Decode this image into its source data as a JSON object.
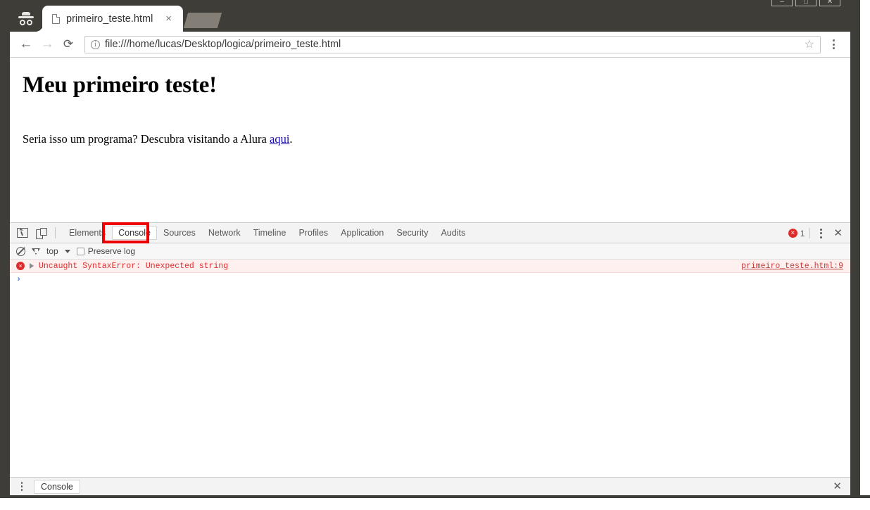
{
  "browser": {
    "incognito_icon": "incognito-icon",
    "window_controls": [
      "minimize",
      "maximize",
      "close"
    ],
    "tab": {
      "title": "primeiro_teste.html",
      "favicon": "page-file-icon",
      "close_label": "×"
    },
    "toolbar": {
      "back_icon": "←",
      "forward_icon": "→",
      "reload_icon": "⟳",
      "site_info_icon": "i",
      "url": "file:///home/lucas/Desktop/logica/primeiro_teste.html",
      "bookmark_icon": "☆"
    }
  },
  "page": {
    "heading": "Meu primeiro teste!",
    "paragraph_before": "Seria isso um programa? Descubra visitando a Alura ",
    "link_text": "aqui",
    "paragraph_after": "."
  },
  "devtools": {
    "tabs": [
      {
        "label": "Elements",
        "selected": false
      },
      {
        "label": "Console",
        "selected": true
      },
      {
        "label": "Sources",
        "selected": false
      },
      {
        "label": "Network",
        "selected": false
      },
      {
        "label": "Timeline",
        "selected": false
      },
      {
        "label": "Profiles",
        "selected": false
      },
      {
        "label": "Application",
        "selected": false
      },
      {
        "label": "Security",
        "selected": false
      },
      {
        "label": "Audits",
        "selected": false
      }
    ],
    "highlight_color": "#ee0000",
    "error_badge": {
      "icon": "×",
      "count": "1"
    },
    "menu_icon": "kebab-menu-icon",
    "close_icon": "✕",
    "filterbar": {
      "clear_icon": "clear-console-icon",
      "filter_icon": "filter-icon",
      "context": "top",
      "caret": "▾",
      "preserve_log_label": "Preserve log",
      "preserve_log_checked": false
    },
    "console": {
      "error": {
        "icon": "×",
        "expand_arrow": "▶",
        "message": "Uncaught SyntaxError: Unexpected string",
        "source": "primeiro_teste.html:9",
        "color": "#e03030",
        "background": "#fff0f0"
      },
      "prompt_caret": "›"
    },
    "drawer": {
      "menu_icon": "kebab-menu-icon",
      "tab_label": "Console",
      "close_icon": "✕"
    }
  }
}
